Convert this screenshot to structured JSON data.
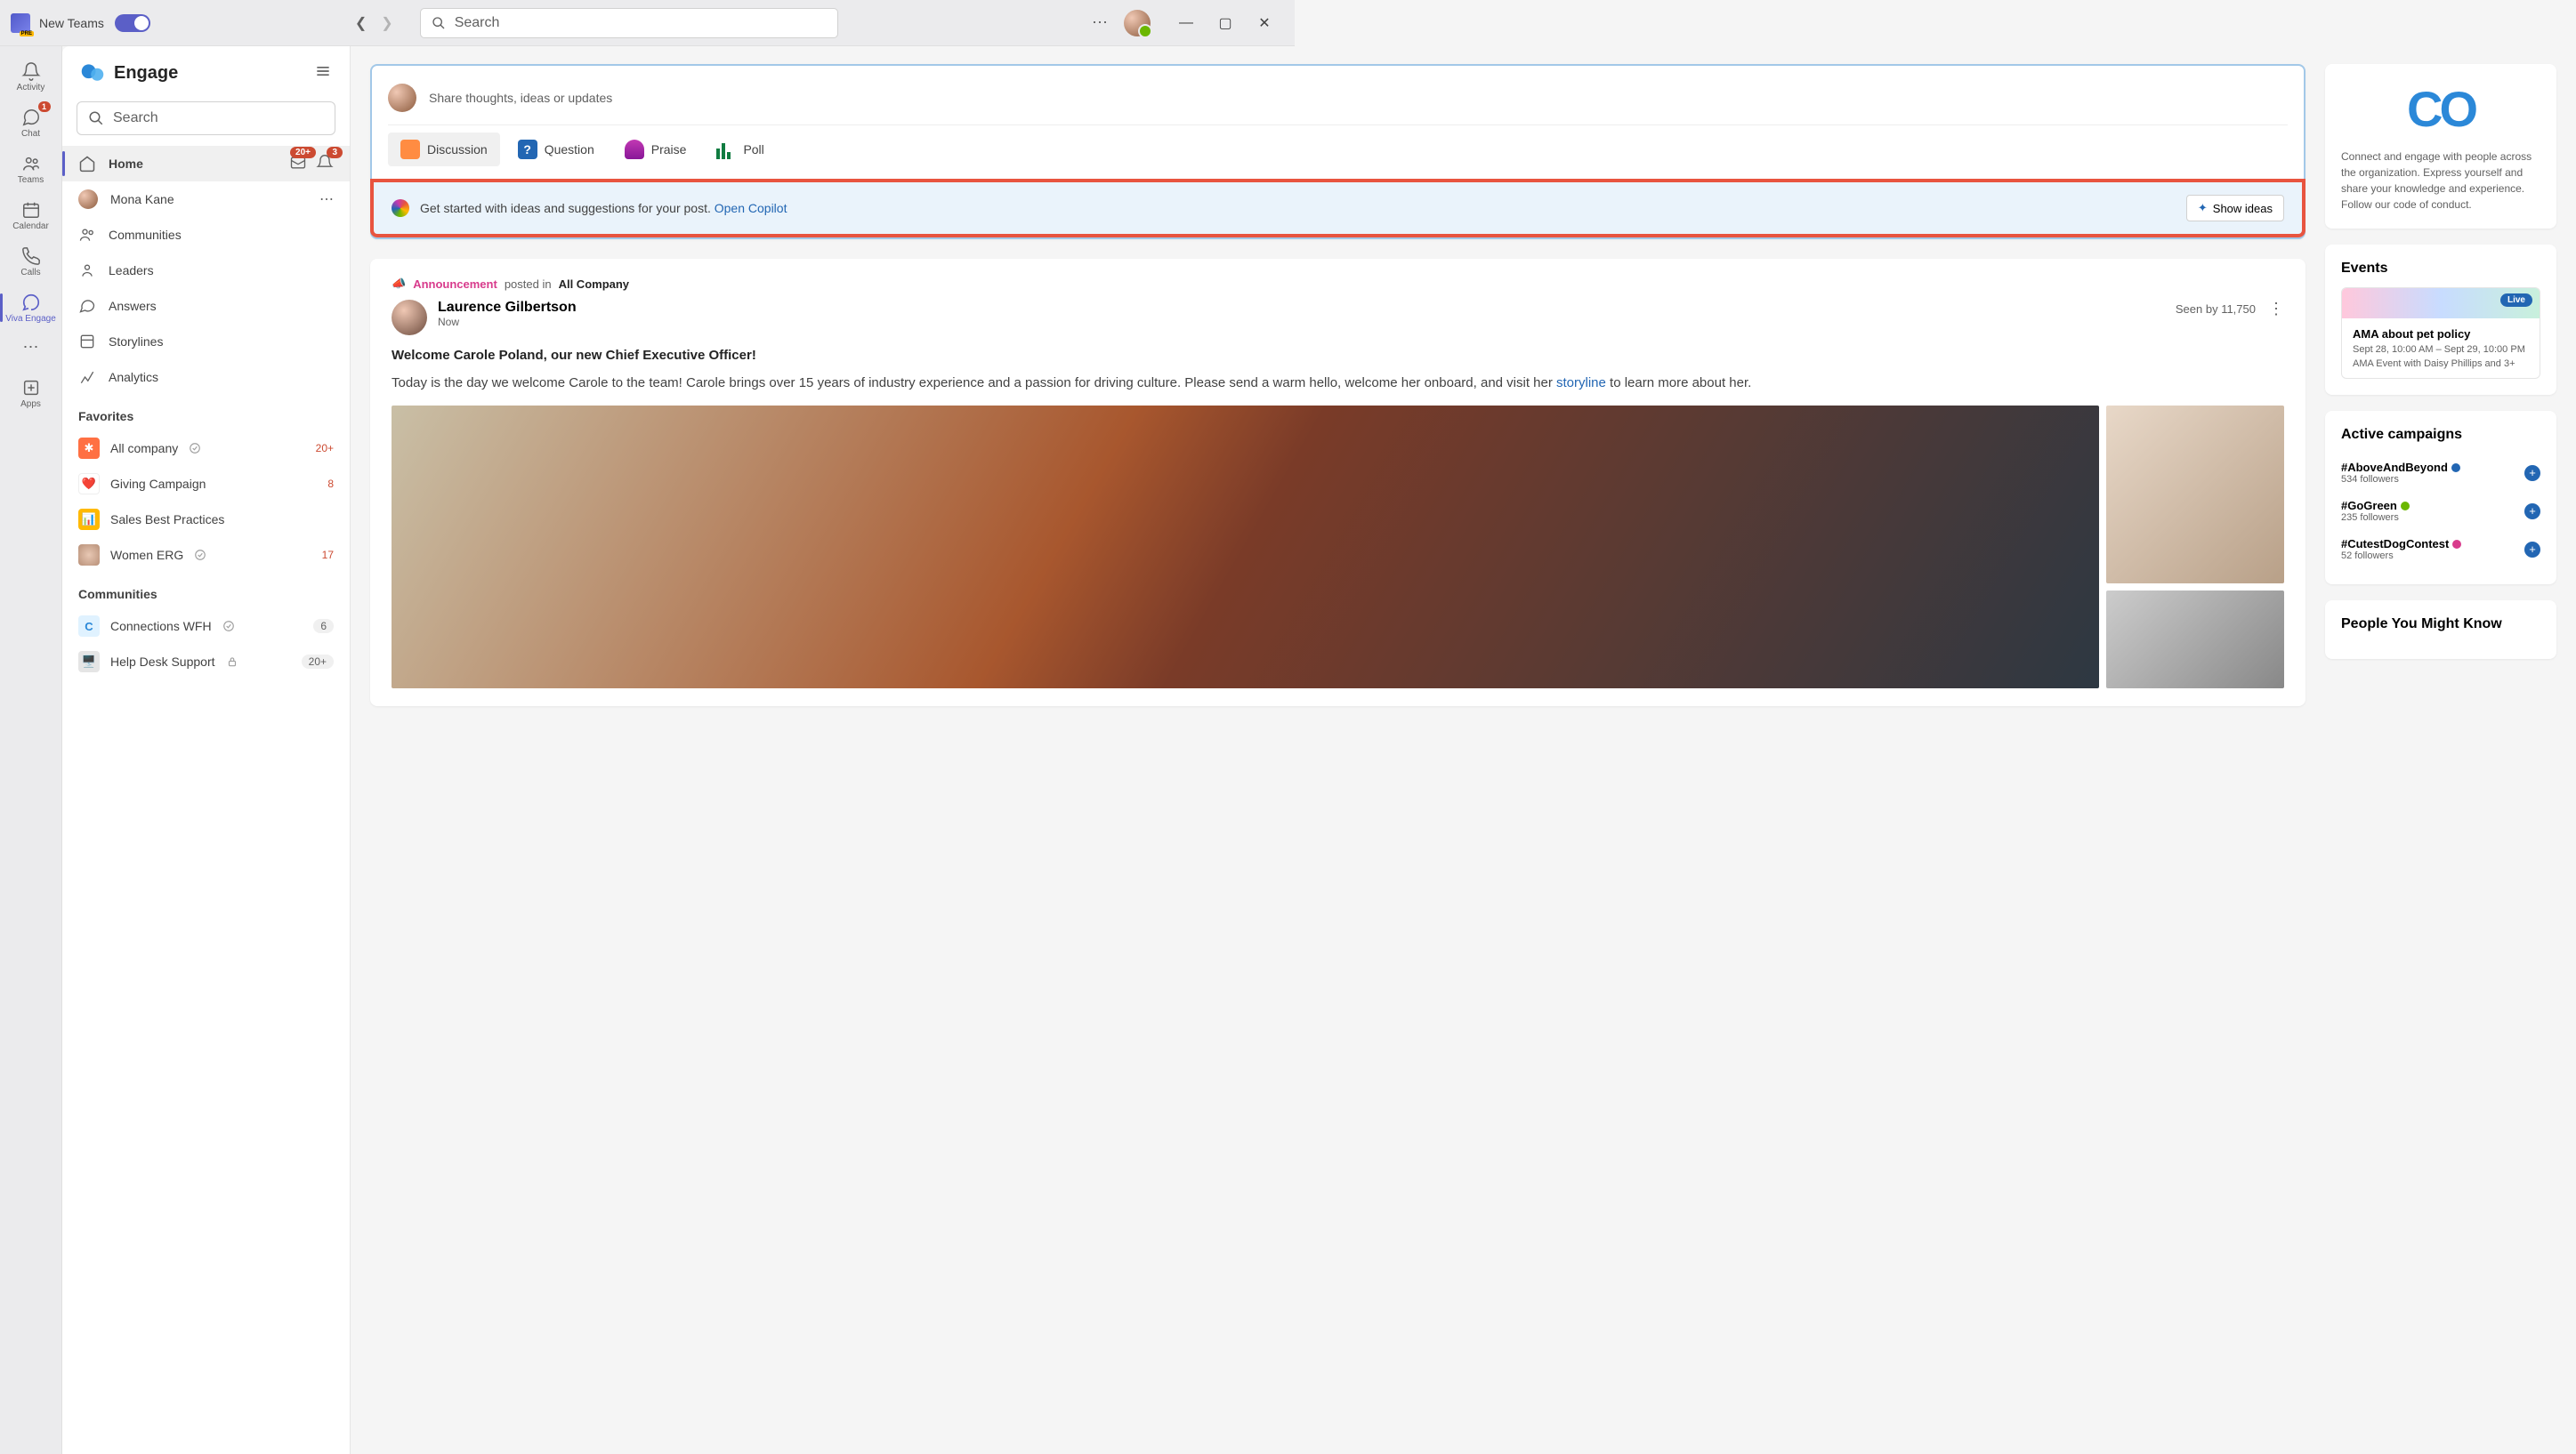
{
  "app_name": "New Teams",
  "search_placeholder": "Search",
  "window_controls": {
    "min": "—",
    "max": "▢",
    "close": "✕"
  },
  "rail": [
    {
      "id": "activity",
      "label": "Activity"
    },
    {
      "id": "chat",
      "label": "Chat",
      "badge": "1"
    },
    {
      "id": "teams",
      "label": "Teams"
    },
    {
      "id": "calendar",
      "label": "Calendar"
    },
    {
      "id": "calls",
      "label": "Calls"
    },
    {
      "id": "viva",
      "label": "Viva Engage",
      "active": true
    },
    {
      "id": "more",
      "label": ""
    },
    {
      "id": "apps",
      "label": "Apps"
    }
  ],
  "engage": {
    "title": "Engage",
    "search_placeholder": "Search",
    "nav": {
      "home": "Home",
      "home_inbox_badge": "20+",
      "home_bell_badge": "3",
      "user": "Mona Kane",
      "communities": "Communities",
      "leaders": "Leaders",
      "answers": "Answers",
      "storylines": "Storylines",
      "analytics": "Analytics"
    },
    "favorites_label": "Favorites",
    "favorites": [
      {
        "name": "All company",
        "count": "20+",
        "icon_bg": "#ff7043",
        "verified": true
      },
      {
        "name": "Giving Campaign",
        "count": "8",
        "icon_bg": "#fff",
        "emoji": "❤️"
      },
      {
        "name": "Sales Best Practices",
        "count": "",
        "icon_bg": "#ffb900",
        "emoji": "📊"
      },
      {
        "name": "Women ERG",
        "count": "17",
        "icon_bg": "#e8d8c8",
        "verified": true
      }
    ],
    "communities_label": "Communities",
    "communities": [
      {
        "name": "Connections WFH",
        "count": "6",
        "count_gray": true,
        "icon_bg": "#e0f2ff",
        "emoji": "©",
        "verified": true
      },
      {
        "name": "Help Desk Support",
        "count": "20+",
        "count_gray": true,
        "icon_bg": "#e5e5e5",
        "emoji": "🧮",
        "lock": true
      }
    ]
  },
  "compose": {
    "placeholder": "Share thoughts, ideas or updates",
    "tabs": {
      "discussion": "Discussion",
      "question": "Question",
      "praise": "Praise",
      "poll": "Poll"
    }
  },
  "copilot": {
    "text": "Get started with ideas and suggestions for your post. ",
    "link": "Open Copilot",
    "button": "Show ideas"
  },
  "post": {
    "ann": "Announcement",
    "posted_in": "posted in ",
    "community": "All Company",
    "author": "Laurence Gilbertson",
    "time": "Now",
    "seen": "Seen by 11,750",
    "title": "Welcome Carole Poland, our new Chief Executive Officer!",
    "body_1": "Today is the day we welcome Carole to the team! Carole brings over 15 years of industry experience and a passion for driving culture. Please send a warm hello, welcome her onboard, and visit her ",
    "body_link": "storyline",
    "body_2": " to learn more about her."
  },
  "side": {
    "co_desc": "Connect and engage with people across the organization. Express yourself and share your knowledge and experience. Follow our code of conduct.",
    "events_title": "Events",
    "event": {
      "live": "Live",
      "title": "AMA about pet policy",
      "time": "Sept 28, 10:00 AM – Sept 29, 10:00 PM",
      "sub": "AMA Event with Daisy Phillips and 3+"
    },
    "campaigns_title": "Active campaigns",
    "campaigns": [
      {
        "tag": "#AboveAndBeyond",
        "sub": "534 followers",
        "color": "#2266b3"
      },
      {
        "tag": "#GoGreen",
        "sub": "235 followers",
        "color": "#6bb700"
      },
      {
        "tag": "#CutestDogContest",
        "sub": "52 followers",
        "color": "#d83b8c"
      }
    ],
    "people_title": "People You Might Know"
  }
}
